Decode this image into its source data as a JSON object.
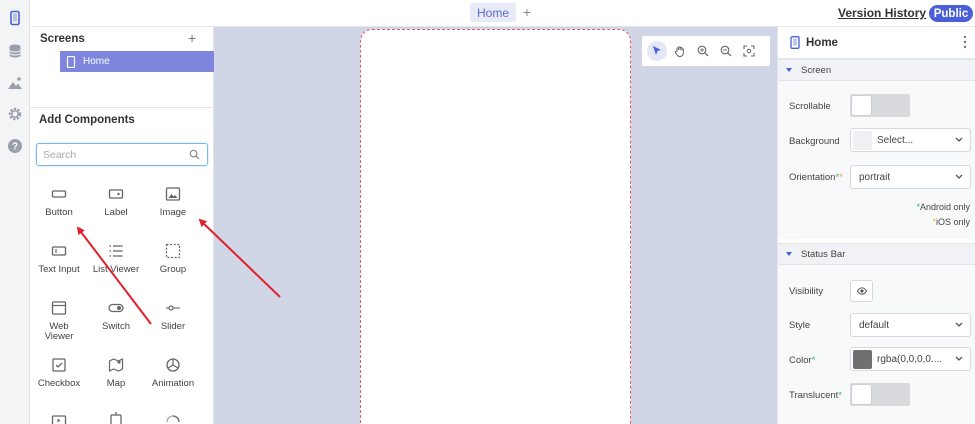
{
  "topbar": {
    "active_tab": "Home",
    "add_tab_glyph": "+",
    "version_history": "Version History",
    "visibility_badge": "Public"
  },
  "rail": {
    "icons": [
      "device-icon",
      "database-icon",
      "images-icon",
      "settings-gear-icon",
      "help-icon"
    ]
  },
  "screens": {
    "title": "Screens",
    "add_glyph": "+",
    "items": [
      {
        "label": "Home",
        "selected": true
      }
    ]
  },
  "add_components": {
    "title": "Add Components",
    "search_placeholder": "Search",
    "items": [
      {
        "label": "Button",
        "icon": "button-icon"
      },
      {
        "label": "Label",
        "icon": "label-icon"
      },
      {
        "label": "Image",
        "icon": "image-icon"
      },
      {
        "label": "Text Input",
        "icon": "text-input-icon"
      },
      {
        "label": "List Viewer",
        "icon": "list-viewer-icon"
      },
      {
        "label": "Group",
        "icon": "group-icon"
      },
      {
        "label": "Web\nViewer",
        "icon": "web-viewer-icon"
      },
      {
        "label": "Switch",
        "icon": "switch-icon"
      },
      {
        "label": "Slider",
        "icon": "slider-icon"
      },
      {
        "label": "Checkbox",
        "icon": "checkbox-icon"
      },
      {
        "label": "Map",
        "icon": "map-icon"
      },
      {
        "label": "Animation",
        "icon": "animation-icon"
      }
    ]
  },
  "canvas_tools": [
    "select-pointer-icon",
    "pan-hand-icon",
    "zoom-in-icon",
    "zoom-out-icon",
    "fit-screen-icon"
  ],
  "properties": {
    "title": "Home",
    "screen_section": {
      "title": "Screen",
      "scrollable_label": "Scrollable",
      "scrollable_on": false,
      "background_label": "Background",
      "background_value": "Select...",
      "background_swatch": "#eef0f4",
      "orientation_label": "Orientation",
      "orientation_value": "portrait",
      "android_only": "Android only",
      "ios_only": "iOS only"
    },
    "status_bar_section": {
      "title": "Status Bar",
      "visibility_label": "Visibility",
      "style_label": "Style",
      "style_value": "default",
      "color_label": "Color",
      "color_value": "rgba(0,0,0,0....",
      "color_swatch": "#707070",
      "translucent_label": "Translucent",
      "translucent_on": false
    }
  },
  "colors": {
    "accent": "#4a5fd9",
    "selected_screen": "#7e85dd",
    "canvas_bg": "#d1d6e7",
    "annotation_arrow": "#e0202a",
    "device_border": "#e05c6a"
  }
}
